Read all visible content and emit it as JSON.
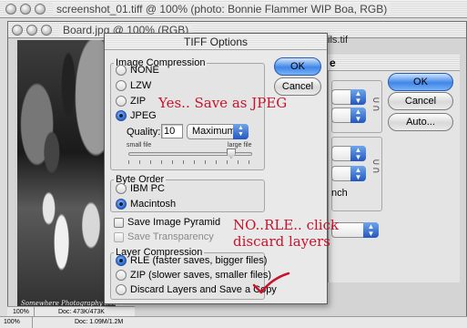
{
  "back_window": {
    "title": "screenshot_01.tiff @ 100% (photo:  Bonnie Flammer WIP Boa, RGB)"
  },
  "mid_window": {
    "title": "Board.jpg @ 100% (RGB)",
    "photo_caption": "Somewhere Photography Board",
    "zoom": "100%",
    "doc_size": "Doc: 473K/473K"
  },
  "back_status": {
    "zoom": "100%",
    "doc_size": "Doc: 1.09M/1.2M"
  },
  "side_dialog": {
    "title_fragment": "e",
    "title_fragment_top": "ils.tif",
    "ok_label": "OK",
    "cancel_label": "Cancel",
    "auto_label": "Auto...",
    "nch_label": "nch"
  },
  "dialog": {
    "title": "TIFF Options",
    "ok_label": "OK",
    "cancel_label": "Cancel",
    "image_compression": {
      "label": "Image Compression",
      "options": [
        "NONE",
        "LZW",
        "ZIP",
        "JPEG"
      ],
      "selected": "JPEG",
      "quality_label": "Quality:",
      "quality_value": "10",
      "quality_preset": "Maximum",
      "small_file_label": "small file",
      "large_file_label": "large file",
      "slider_level": 0.83
    },
    "byte_order": {
      "label": "Byte Order",
      "options": [
        "IBM PC",
        "Macintosh"
      ],
      "selected": "Macintosh"
    },
    "save_image_pyramid": "Save Image Pyramid",
    "save_transparency": "Save Transparency",
    "layer_compression": {
      "label": "Layer Compression",
      "options": [
        "RLE (faster saves, bigger files)",
        "ZIP (slower saves, smaller files)",
        "Discard Layers and Save a Copy"
      ],
      "selected": "RLE (faster saves, bigger files)"
    }
  },
  "annotations": {
    "jpeg_note": "Yes.. Save as JPEG",
    "layers_note_line1": "NO..RLE.. click",
    "layers_note_line2": "discard layers",
    "accent_color": "#c9132b"
  }
}
